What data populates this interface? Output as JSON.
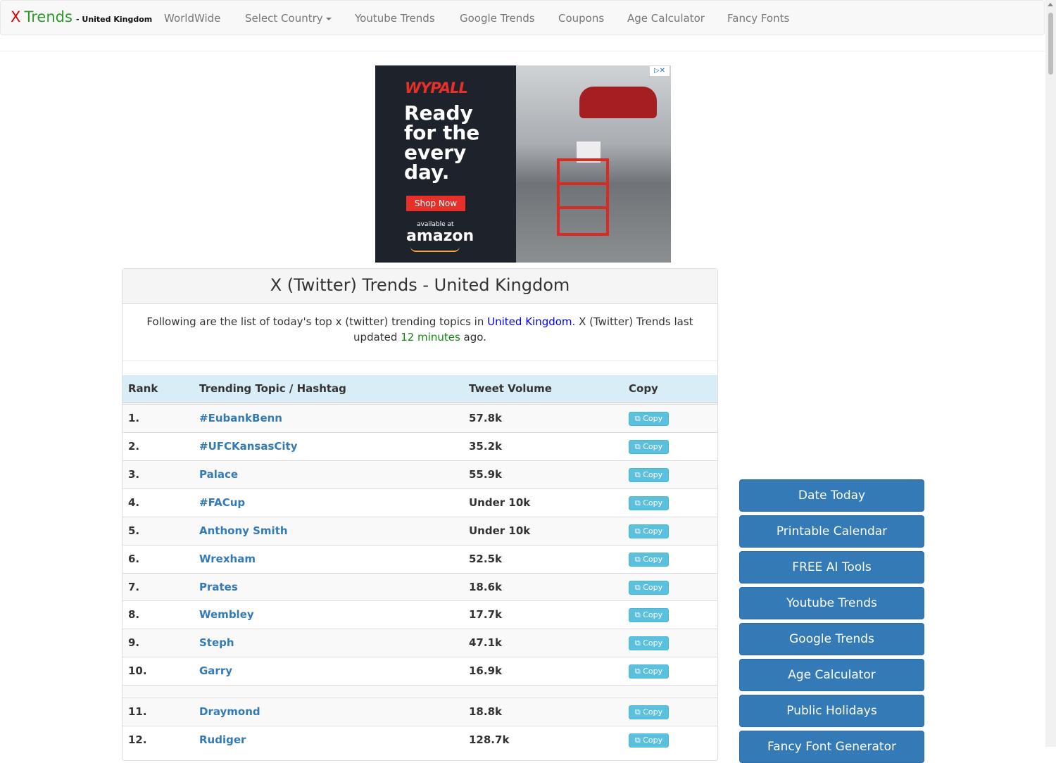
{
  "brand": {
    "x": "X",
    "trends": "Trends",
    "sub": "- United Kingdom"
  },
  "nav": {
    "items": [
      "WorldWide",
      "Select Country",
      "Youtube Trends",
      "Google Trends",
      "Coupons",
      "Age Calculator",
      "Fancy Fonts"
    ]
  },
  "ad": {
    "logo": "WYPALL",
    "headline": "Ready for the every day.",
    "cta": "Shop Now",
    "available": "available at",
    "amazon": "amazon",
    "choices": "▷✕"
  },
  "panel": {
    "title": "X (Twitter) Trends - United Kingdom",
    "intro_a": "Following are the list of today's top x (twitter) trending topics in ",
    "intro_country": "United Kingdom",
    "intro_b": ". X (Twitter) Trends last updated ",
    "intro_minutes": "12 minutes",
    "intro_c": " ago."
  },
  "table": {
    "headers": {
      "rank": "Rank",
      "topic": "Trending Topic / Hashtag",
      "volume": "Tweet Volume",
      "copy": "Copy"
    },
    "copy_label": "Copy",
    "rows": [
      {
        "rank": "1.",
        "topic": "#EubankBenn",
        "volume": "57.8k"
      },
      {
        "rank": "2.",
        "topic": "#UFCKansasCity",
        "volume": "35.2k"
      },
      {
        "rank": "3.",
        "topic": "Palace",
        "volume": "55.9k"
      },
      {
        "rank": "4.",
        "topic": "#FACup",
        "volume": "Under 10k"
      },
      {
        "rank": "5.",
        "topic": "Anthony Smith",
        "volume": "Under 10k"
      },
      {
        "rank": "6.",
        "topic": "Wrexham",
        "volume": "52.5k"
      },
      {
        "rank": "7.",
        "topic": "Prates",
        "volume": "18.6k"
      },
      {
        "rank": "8.",
        "topic": "Wembley",
        "volume": "17.7k"
      },
      {
        "rank": "9.",
        "topic": "Steph",
        "volume": "47.1k"
      },
      {
        "rank": "10.",
        "topic": "Garry",
        "volume": "16.9k"
      },
      {
        "rank": "11.",
        "topic": "Draymond",
        "volume": "18.8k"
      },
      {
        "rank": "12.",
        "topic": "Rudiger",
        "volume": "128.7k"
      }
    ]
  },
  "sidebar": {
    "buttons": [
      "Date Today",
      "Printable Calendar",
      "FREE AI Tools",
      "Youtube Trends",
      "Google Trends",
      "Age Calculator",
      "Public Holidays",
      "Fancy Font Generator"
    ]
  }
}
